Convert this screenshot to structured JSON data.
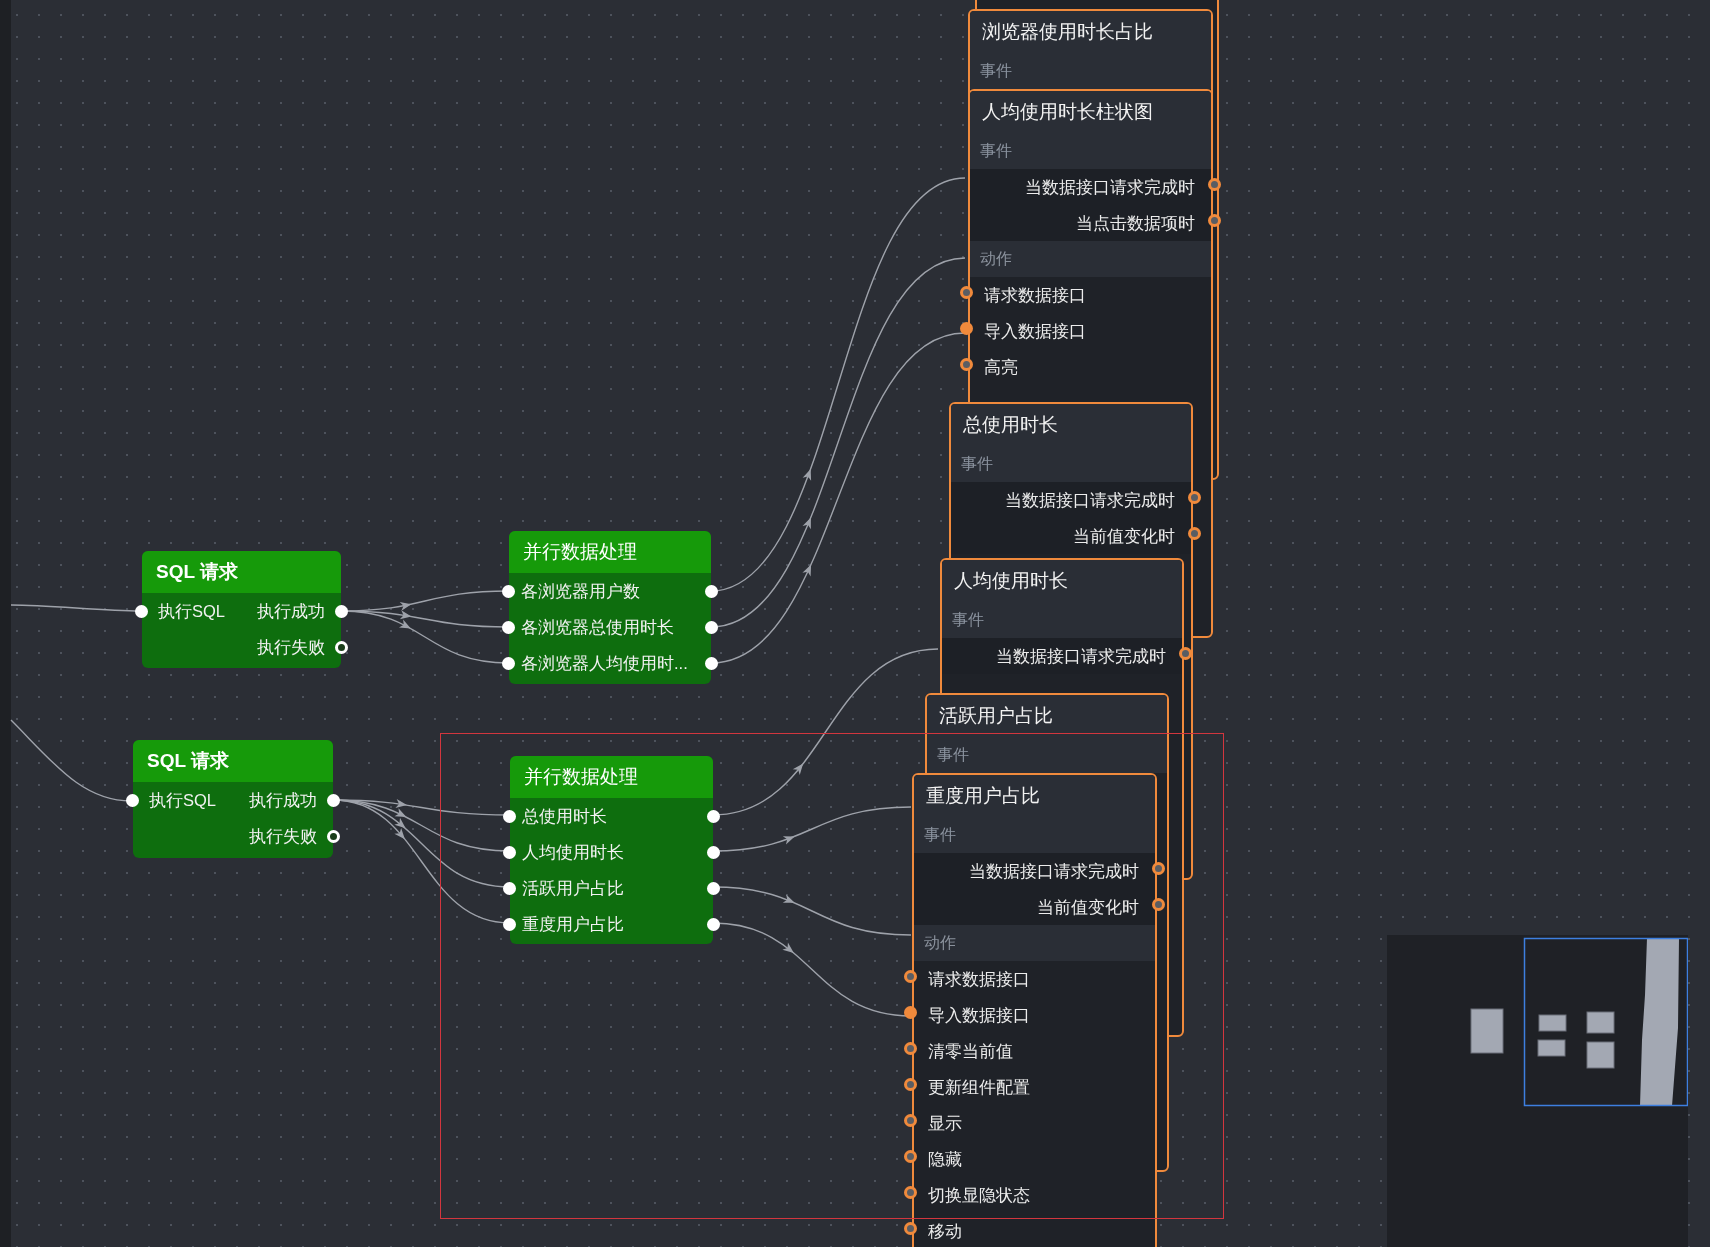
{
  "canvas": {
    "nodes": [
      {
        "kind": "component"
      },
      {
        "kind": "component",
        "title": "浏览器使用时长占比",
        "sections": [
          {
            "kind": "events",
            "label": "事件"
          }
        ]
      },
      {
        "kind": "component",
        "title": "人均使用时长柱状图",
        "sections": [
          {
            "kind": "events",
            "label": "事件",
            "rows": [
              {
                "label": "当数据接口请求完成时",
                "connected": false
              },
              {
                "label": "当点击数据项时",
                "connected": false
              }
            ]
          },
          {
            "kind": "actions",
            "label": "动作",
            "rows": [
              {
                "label": "请求数据接口",
                "connected": false
              },
              {
                "label": "导入数据接口",
                "connected": true
              },
              {
                "label": "高亮",
                "connected": false
              }
            ]
          }
        ]
      },
      {
        "kind": "component",
        "title": "总使用时长",
        "sections": [
          {
            "kind": "events",
            "label": "事件",
            "rows": [
              {
                "label": "当数据接口请求完成时",
                "connected": false
              },
              {
                "label": "当前值变化时",
                "connected": false
              }
            ]
          }
        ]
      },
      {
        "kind": "component",
        "title": "人均使用时长",
        "sections": [
          {
            "kind": "events",
            "label": "事件",
            "rows": [
              {
                "label": "当数据接口请求完成时",
                "connected": false
              }
            ]
          }
        ]
      },
      {
        "kind": "component",
        "title": "活跃用户占比",
        "sections": [
          {
            "kind": "events",
            "label": "事件"
          }
        ]
      },
      {
        "kind": "component",
        "title": "重度用户占比",
        "sections": [
          {
            "kind": "events",
            "label": "事件",
            "rows": [
              {
                "label": "当数据接口请求完成时",
                "connected": false
              },
              {
                "label": "当前值变化时",
                "connected": false
              }
            ]
          },
          {
            "kind": "actions",
            "label": "动作",
            "rows": [
              {
                "label": "请求数据接口",
                "connected": false
              },
              {
                "label": "导入数据接口",
                "connected": true
              },
              {
                "label": "清零当前值",
                "connected": false
              },
              {
                "label": "更新组件配置",
                "connected": false
              },
              {
                "label": "显示",
                "connected": false
              },
              {
                "label": "隐藏",
                "connected": false
              },
              {
                "label": "切换显隐状态",
                "connected": false
              },
              {
                "label": "移动",
                "connected": false
              }
            ]
          }
        ]
      },
      {
        "kind": "sql",
        "title": "SQL 请求",
        "rows": [
          {
            "input": "执行SQL",
            "output": "执行成功",
            "connected": true
          },
          {
            "output": "执行失败",
            "connected": false
          }
        ]
      },
      {
        "kind": "parallel",
        "title": "并行数据处理",
        "rows": [
          {
            "label": "各浏览器用户数"
          },
          {
            "label": "各浏览器总使用时长"
          },
          {
            "label": "各浏览器人均使用时..."
          }
        ]
      },
      {
        "kind": "sql",
        "title": "SQL 请求",
        "rows": [
          {
            "input": "执行SQL",
            "output": "执行成功",
            "connected": true
          },
          {
            "output": "执行失败",
            "connected": false
          }
        ]
      },
      {
        "kind": "parallel",
        "title": "并行数据处理",
        "rows": [
          {
            "label": "总使用时长"
          },
          {
            "label": "人均使用时长"
          },
          {
            "label": "活跃用户占比"
          },
          {
            "label": "重度用户占比"
          }
        ]
      }
    ]
  }
}
